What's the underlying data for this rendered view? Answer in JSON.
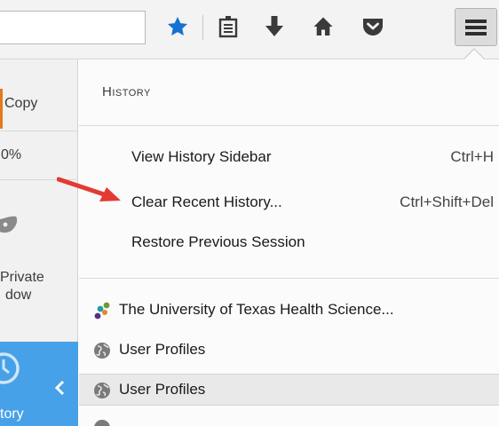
{
  "toolbar": {
    "icons": [
      "bookmark-star-icon",
      "reading-list-icon",
      "downloads-arrow-icon",
      "home-icon",
      "pocket-icon",
      "hamburger-menu-icon"
    ]
  },
  "left_panel": {
    "copy_label": "Copy",
    "zoom_label": "0%",
    "private_label_1": "Private",
    "private_label_2": "dow",
    "history_label": "tory"
  },
  "history_panel": {
    "title": "History",
    "actions": [
      {
        "label": "View History Sidebar",
        "shortcut": "Ctrl+H"
      },
      {
        "label": "Clear Recent History...",
        "shortcut": "Ctrl+Shift+Del"
      },
      {
        "label": "Restore Previous Session",
        "shortcut": ""
      }
    ],
    "entries": [
      {
        "label": "The University of Texas Health Science...",
        "icon": "ut-health-favicon"
      },
      {
        "label": "User Profiles",
        "icon": "globe-icon"
      },
      {
        "label": "User Profiles",
        "icon": "globe-icon"
      }
    ]
  },
  "colors": {
    "accent_blue": "#1572d2",
    "history_blue": "#46a1e8",
    "annotation_red": "#e23b33",
    "orange_accent": "#e4791d"
  }
}
